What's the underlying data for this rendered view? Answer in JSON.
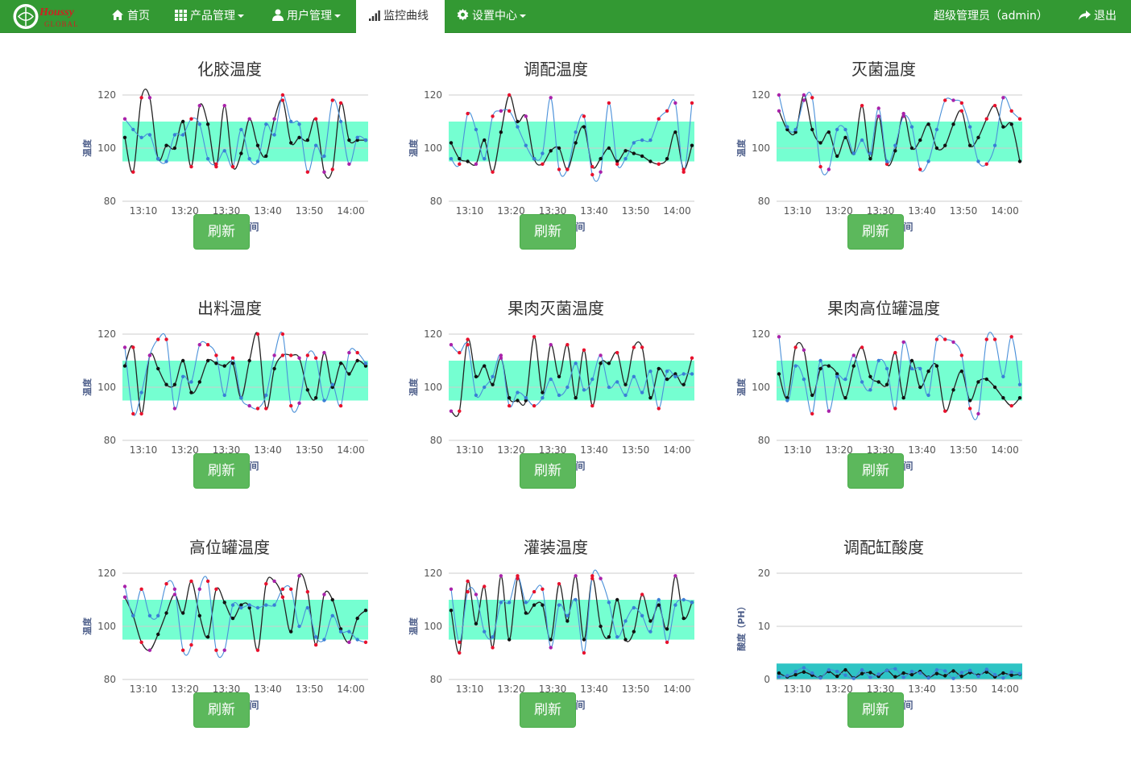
{
  "navbar": {
    "brand": "Houssy GLOBAL",
    "items": [
      {
        "label": "首页",
        "icon": "home-icon"
      },
      {
        "label": "产品管理",
        "icon": "grid-icon"
      },
      {
        "label": "用户管理",
        "icon": "user-icon"
      },
      {
        "label": "监控曲线",
        "icon": "signal-bars-icon"
      },
      {
        "label": "设置中心",
        "icon": "gear-icon"
      }
    ],
    "user": "超级管理员（admin）",
    "logout": "退出",
    "colors": {
      "bar": "#339933",
      "active_bg": "#ffffff"
    }
  },
  "charts": [
    {
      "title": "化胶温度",
      "button": "刷新"
    },
    {
      "title": "调配温度",
      "button": "刷新"
    },
    {
      "title": "灭菌温度",
      "button": "刷新"
    },
    {
      "title": "出料温度",
      "button": "刷新"
    },
    {
      "title": "果肉灭菌温度",
      "button": "刷新"
    },
    {
      "title": "果肉高位罐温度",
      "button": "刷新"
    },
    {
      "title": "高位罐温度",
      "button": "刷新"
    },
    {
      "title": "灌装温度",
      "button": "刷新"
    },
    {
      "title": "调配缸酸度",
      "button": "刷新"
    }
  ],
  "chart_data": [
    {
      "type": "line",
      "title": "化胶温度",
      "ylabel": "温度",
      "xlabel": "时间",
      "ylim": [
        80,
        120
      ],
      "yticks": [
        80,
        100,
        120
      ],
      "xticks": [
        "13:10",
        "13:20",
        "13:30",
        "13:40",
        "13:50",
        "14:00"
      ],
      "band": [
        95,
        110
      ],
      "band_color": "#66ffcc",
      "series": [
        {
          "color": "#222222",
          "values": [
            104,
            91,
            119,
            119,
            96,
            101,
            100,
            110,
            93,
            116,
            109,
            93,
            116,
            93,
            98,
            111,
            101,
            97,
            111,
            118,
            102,
            104,
            103,
            111,
            91,
            92,
            117,
            103,
            103,
            103
          ]
        },
        {
          "color": "#4a90d9",
          "values": [
            111,
            107,
            104,
            105,
            96,
            95,
            105,
            105,
            111,
            109,
            96,
            94,
            99,
            93,
            107,
            96,
            95,
            109,
            105,
            120,
            110,
            109,
            91,
            101,
            97,
            118,
            110,
            94,
            104,
            103
          ]
        }
      ]
    },
    {
      "type": "line",
      "title": "调配温度",
      "ylabel": "温度",
      "xlabel": "时间",
      "ylim": [
        80,
        120
      ],
      "yticks": [
        80,
        100,
        120
      ],
      "xticks": [
        "13:10",
        "13:20",
        "13:30",
        "13:40",
        "13:50",
        "14:00"
      ],
      "band": [
        95,
        110
      ],
      "band_color": "#66ffcc",
      "series": [
        {
          "color": "#222222",
          "values": [
            102,
            96,
            95,
            94,
            103,
            91,
            106,
            120,
            110,
            112,
            96,
            94,
            99,
            100,
            92,
            102,
            108,
            93,
            96,
            100,
            95,
            99,
            98,
            97,
            95,
            94,
            96,
            106,
            92,
            101
          ]
        },
        {
          "color": "#4a90d9",
          "values": [
            96,
            94,
            113,
            107,
            96,
            112,
            114,
            114,
            108,
            101,
            96,
            98,
            119,
            92,
            92,
            106,
            112,
            90,
            91,
            117,
            94,
            96,
            102,
            103,
            103,
            111,
            114,
            117,
            91,
            117
          ]
        }
      ]
    },
    {
      "type": "line",
      "title": "灭菌温度",
      "ylabel": "温度",
      "xlabel": "时间",
      "ylim": [
        80,
        120
      ],
      "yticks": [
        80,
        100,
        120
      ],
      "xticks": [
        "13:10",
        "13:20",
        "13:30",
        "13:40",
        "13:50",
        "14:00"
      ],
      "band": [
        95,
        110
      ],
      "band_color": "#66ffcc",
      "series": [
        {
          "color": "#222222",
          "values": [
            114,
            107,
            106,
            120,
            107,
            102,
            106,
            97,
            104,
            98,
            116,
            96,
            112,
            94,
            99,
            113,
            100,
            103,
            109,
            100,
            101,
            109,
            114,
            101,
            104,
            111,
            116,
            108,
            109,
            95
          ]
        },
        {
          "color": "#4a90d9",
          "values": [
            120,
            108,
            107,
            118,
            119,
            93,
            92,
            107,
            107,
            98,
            103,
            98,
            115,
            95,
            101,
            112,
            108,
            92,
            95,
            107,
            118,
            118,
            117,
            108,
            95,
            94,
            101,
            119,
            114,
            111
          ]
        }
      ]
    },
    {
      "type": "line",
      "title": "出料温度",
      "ylabel": "温度",
      "xlabel": "时间",
      "ylim": [
        80,
        120
      ],
      "yticks": [
        80,
        100,
        120
      ],
      "xticks": [
        "13:10",
        "13:20",
        "13:30",
        "13:40",
        "13:50",
        "14:00"
      ],
      "band": [
        95,
        110
      ],
      "band_color": "#66ffcc",
      "series": [
        {
          "color": "#222222",
          "values": [
            108,
            115,
            90,
            112,
            107,
            101,
            101,
            110,
            98,
            102,
            110,
            109,
            108,
            109,
            96,
            110,
            120,
            92,
            107,
            112,
            112,
            111,
            99,
            96,
            113,
            100,
            109,
            105,
            110,
            108
          ]
        },
        {
          "color": "#4a90d9",
          "values": [
            115,
            90,
            98,
            112,
            118,
            118,
            92,
            104,
            102,
            116,
            116,
            112,
            97,
            111,
            96,
            93,
            92,
            97,
            112,
            120,
            93,
            94,
            112,
            111,
            95,
            101,
            93,
            113,
            113,
            109
          ]
        }
      ]
    },
    {
      "type": "line",
      "title": "果肉灭菌温度",
      "ylabel": "温度",
      "xlabel": "时间",
      "ylim": [
        80,
        120
      ],
      "yticks": [
        80,
        100,
        120
      ],
      "xticks": [
        "13:10",
        "13:20",
        "13:30",
        "13:40",
        "13:50",
        "14:00"
      ],
      "band": [
        95,
        110
      ],
      "band_color": "#66ffcc",
      "series": [
        {
          "color": "#222222",
          "values": [
            91,
            91,
            118,
            104,
            108,
            101,
            111,
            96,
            95,
            95,
            119,
            98,
            116,
            104,
            116,
            96,
            114,
            93,
            109,
            109,
            113,
            101,
            115,
            115,
            96,
            107,
            103,
            105,
            101,
            111
          ]
        },
        {
          "color": "#4a90d9",
          "values": [
            116,
            113,
            116,
            97,
            100,
            104,
            112,
            93,
            98,
            96,
            93,
            96,
            103,
            97,
            100,
            109,
            99,
            103,
            112,
            100,
            102,
            97,
            104,
            98,
            106,
            92,
            106,
            104,
            105,
            105
          ]
        }
      ]
    },
    {
      "type": "line",
      "title": "果肉高位罐温度",
      "ylabel": "温度",
      "xlabel": "时间",
      "ylim": [
        80,
        120
      ],
      "yticks": [
        80,
        100,
        120
      ],
      "xticks": [
        "13:10",
        "13:20",
        "13:30",
        "13:40",
        "13:50",
        "14:00"
      ],
      "band": [
        95,
        110
      ],
      "band_color": "#66ffcc",
      "series": [
        {
          "color": "#222222",
          "values": [
            105,
            96,
            115,
            114,
            97,
            107,
            108,
            105,
            96,
            108,
            115,
            104,
            102,
            101,
            113,
            96,
            110,
            100,
            106,
            108,
            91,
            99,
            106,
            95,
            102,
            103,
            100,
            96,
            93,
            96
          ]
        },
        {
          "color": "#4a90d9",
          "values": [
            119,
            95,
            108,
            103,
            90,
            110,
            91,
            104,
            103,
            112,
            102,
            99,
            110,
            107,
            92,
            117,
            107,
            107,
            97,
            118,
            118,
            117,
            112,
            92,
            90,
            118,
            118,
            104,
            119,
            101
          ]
        }
      ]
    },
    {
      "type": "line",
      "title": "高位罐温度",
      "ylabel": "温度",
      "xlabel": "时间",
      "ylim": [
        80,
        120
      ],
      "yticks": [
        80,
        100,
        120
      ],
      "xticks": [
        "13:10",
        "13:20",
        "13:30",
        "13:40",
        "13:50",
        "14:00"
      ],
      "band": [
        95,
        110
      ],
      "band_color": "#66ffcc",
      "series": [
        {
          "color": "#222222",
          "values": [
            111,
            104,
            94,
            91,
            97,
            105,
            112,
            105,
            117,
            104,
            96,
            114,
            109,
            103,
            108,
            107,
            91,
            116,
            117,
            111,
            98,
            119,
            113,
            93,
            112,
            110,
            99,
            94,
            103,
            106
          ]
        },
        {
          "color": "#4a90d9",
          "values": [
            115,
            104,
            114,
            104,
            104,
            116,
            114,
            91,
            93,
            114,
            117,
            91,
            91,
            108,
            107,
            108,
            107,
            108,
            108,
            114,
            114,
            100,
            107,
            96,
            95,
            104,
            98,
            98,
            95,
            94
          ]
        }
      ]
    },
    {
      "type": "line",
      "title": "灌装温度",
      "ylabel": "温度",
      "xlabel": "时间",
      "ylim": [
        80,
        120
      ],
      "yticks": [
        80,
        100,
        120
      ],
      "xticks": [
        "13:10",
        "13:20",
        "13:30",
        "13:40",
        "13:50",
        "14:00"
      ],
      "band": [
        95,
        110
      ],
      "band_color": "#66ffcc",
      "series": [
        {
          "color": "#222222",
          "values": [
            106,
            90,
            117,
            101,
            115,
            92,
            119,
            95,
            118,
            105,
            108,
            108,
            95,
            116,
            102,
            119,
            95,
            118,
            100,
            96,
            110,
            95,
            98,
            112,
            102,
            108,
            99,
            119,
            103,
            109
          ]
        },
        {
          "color": "#4a90d9",
          "values": [
            114,
            94,
            113,
            112,
            98,
            96,
            109,
            109,
            119,
            109,
            113,
            114,
            92,
            108,
            104,
            110,
            90,
            119,
            118,
            109,
            96,
            102,
            107,
            104,
            98,
            110,
            94,
            108,
            110,
            109
          ]
        }
      ]
    },
    {
      "type": "line",
      "title": "调配缸酸度",
      "ylabel": "酸度（PH）",
      "xlabel": "时间",
      "ylim": [
        0,
        20
      ],
      "yticks": [
        0,
        10,
        20
      ],
      "xticks": [
        "13:10",
        "13:20",
        "13:30",
        "13:40",
        "13:50",
        "14:00"
      ],
      "band": [
        0,
        3
      ],
      "band_color": "#2ec4c4",
      "series": [
        {
          "color": "#222222",
          "values": [
            1.2,
            0.5,
            0.9,
            1.4,
            0.8,
            0.4,
            1.5,
            0.6,
            1.8,
            0.3,
            1.1,
            1.3,
            0.6,
            1.7,
            0.5,
            1.2,
            0.9,
            1.5,
            0.4,
            1.1,
            0.7,
            1.6,
            0.6,
            1.3,
            0.8,
            1.4,
            0.5,
            1.2,
            0.8,
            1.0
          ]
        },
        {
          "color": "#4a90d9",
          "values": [
            0.5,
            0.7,
            1.5,
            2.2,
            1.2,
            0.3,
            1.8,
            1.5,
            0.8,
            0.2,
            1.8,
            0.4,
            1.0,
            1.7,
            2.0,
            0.4,
            1.5,
            1.2,
            0.3,
            1.8,
            1.6,
            0.2,
            1.3,
            1.7,
            0.6,
            1.9,
            0.9,
            0.3,
            1.4,
            1.1
          ]
        }
      ]
    }
  ]
}
